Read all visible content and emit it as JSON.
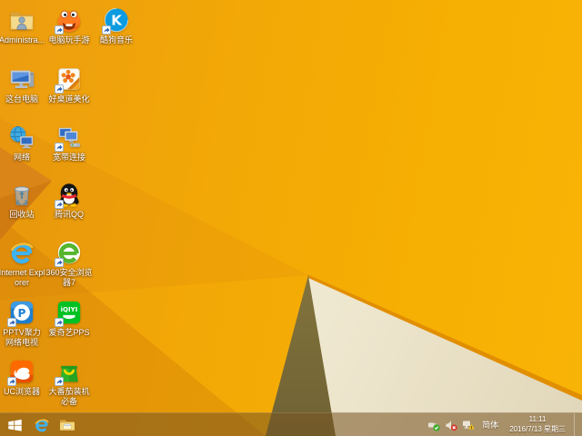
{
  "desktop": {
    "icons": [
      {
        "id": "user-folder",
        "label": "Administra...",
        "col": 0,
        "row": 0,
        "shortcut": false
      },
      {
        "id": "pc-mobile-games",
        "label": "电脑玩手游",
        "col": 1,
        "row": 0,
        "shortcut": true
      },
      {
        "id": "kugou-music",
        "label": "酷狗音乐",
        "col": 2,
        "row": 0,
        "shortcut": true
      },
      {
        "id": "this-pc",
        "label": "这台电脑",
        "col": 0,
        "row": 1,
        "shortcut": false
      },
      {
        "id": "haozhuodao",
        "label": "好桌道美化",
        "col": 1,
        "row": 1,
        "shortcut": true
      },
      {
        "id": "network",
        "label": "网络",
        "col": 0,
        "row": 2,
        "shortcut": false
      },
      {
        "id": "broadband",
        "label": "宽带连接",
        "col": 1,
        "row": 2,
        "shortcut": true
      },
      {
        "id": "recycle-bin",
        "label": "回收站",
        "col": 0,
        "row": 3,
        "shortcut": false
      },
      {
        "id": "tencent-qq",
        "label": "腾讯QQ",
        "col": 1,
        "row": 3,
        "shortcut": true
      },
      {
        "id": "internet-explorer",
        "label": "Internet Explorer",
        "col": 0,
        "row": 4,
        "shortcut": false
      },
      {
        "id": "360-browser",
        "label": "360安全浏览器7",
        "col": 1,
        "row": 4,
        "shortcut": true
      },
      {
        "id": "pptv",
        "label": "PPTV聚力 网络电视",
        "col": 0,
        "row": 5,
        "shortcut": true
      },
      {
        "id": "iqiyi-pps",
        "label": "爱奇艺PPS",
        "col": 1,
        "row": 5,
        "shortcut": true
      },
      {
        "id": "uc-browser",
        "label": "UC浏览器",
        "col": 0,
        "row": 6,
        "shortcut": true
      },
      {
        "id": "tomato-essentials",
        "label": "大番茄装机必备",
        "col": 1,
        "row": 6,
        "shortcut": true
      }
    ]
  },
  "taskbar": {
    "pinned": [
      {
        "id": "ie-taskbar-icon"
      },
      {
        "id": "file-explorer-icon"
      }
    ],
    "tray": {
      "icons": [
        {
          "id": "usb-safe-remove-icon"
        },
        {
          "id": "volume-muted-icon"
        },
        {
          "id": "network-warning-icon"
        }
      ],
      "ime": "简体",
      "time": "11:11",
      "date": "2016/7/13 星期三"
    }
  },
  "colors": {
    "wallpaper_bright": "#F6AF03",
    "wallpaper_deep": "#EC9D10",
    "wallpaper_facet": "#D8821B",
    "wallpaper_cream": "#F2ECDA",
    "wallpaper_olive": "#8E7F45",
    "fold_edge": "#E18E00",
    "taskbar_tint": "#765422",
    "label_text": "#FFFFFF",
    "kugou_blue": "#0C9BE0",
    "iqiyi_green": "#00C123",
    "uc_orange": "#FF6A00",
    "qq_scarf_red": "#E8262D",
    "ie_blue": "#2EA3E8",
    "360_green": "#55B52E"
  }
}
